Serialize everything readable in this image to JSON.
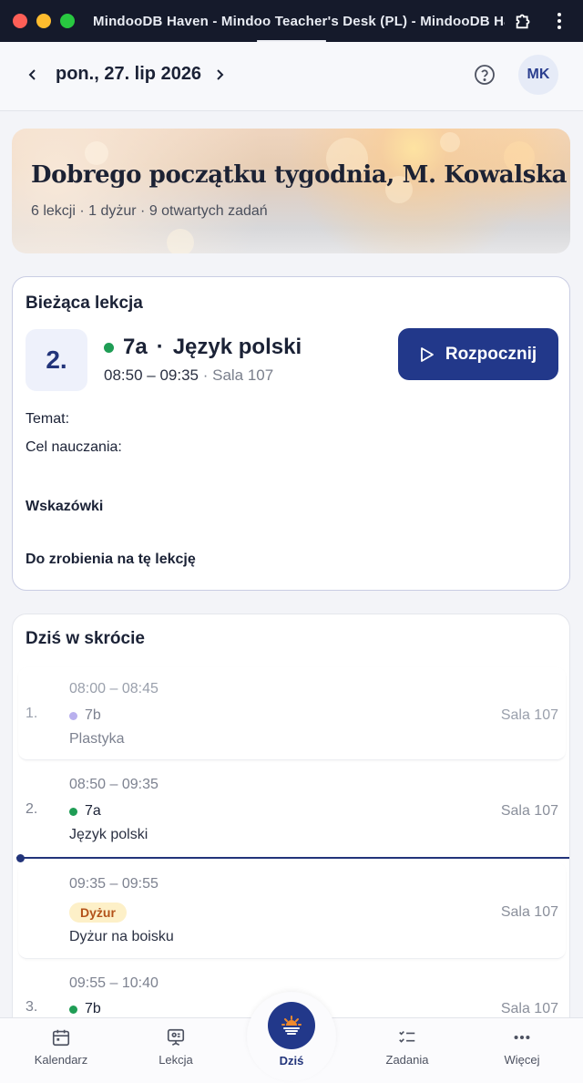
{
  "window": {
    "title": "MindooDB Haven - Mindoo Teacher's Desk (PL) - MindooDB Haven",
    "traffic_lights": [
      "#fe5f57",
      "#febc2e",
      "#28c840"
    ]
  },
  "header": {
    "date": "pon., 27. lip 2026",
    "prev_icon": "chevron-left-icon",
    "next_icon": "chevron-right-icon",
    "help_icon": "question-circle-icon",
    "avatar_initials": "MK"
  },
  "hero": {
    "title": "Dobrego początku tygodnia, M. Kowalska",
    "subtitle": "6 lekcji · 1 dyżur · 9 otwartych zadań"
  },
  "current_lesson": {
    "heading": "Bieżąca lekcja",
    "number": "2.",
    "class": "7a",
    "separator": "·",
    "subject": "Język polski",
    "time": "08:50 – 09:35",
    "room": "· Sala 107",
    "class_color": "#1f9d55",
    "start_button": "Rozpocznij",
    "fields": {
      "topic": "Temat:",
      "goal": "Cel nauczania:",
      "hints": "Wskazówki",
      "todo": "Do zrobienia na tę lekcję"
    }
  },
  "today": {
    "heading": "Dziś w skrócie",
    "rows": [
      {
        "num": "1.",
        "time": "08:00 – 08:45",
        "class": "7b",
        "subject": "Plastyka",
        "room": "Sala 107",
        "dot_color": "#b9b0ee",
        "past": true
      },
      {
        "num": "2.",
        "time": "08:50 – 09:35",
        "class": "7a",
        "subject": "Język polski",
        "room": "Sala 107",
        "dot_color": "#1f9d55",
        "past": false
      },
      {
        "num": "",
        "time": "09:35 – 09:55",
        "badge": "Dyżur",
        "subject": "Dyżur na boisku",
        "room": "Sala 107",
        "past": false
      },
      {
        "num": "3.",
        "time": "09:55 – 10:40",
        "class": "7b",
        "subject": "",
        "room": "Sala 107",
        "dot_color": "#1f9d55",
        "past": false
      }
    ]
  },
  "bottom_nav": {
    "calendar": "Kalendarz",
    "lesson": "Lekcja",
    "today": "Dziś",
    "tasks": "Zadania",
    "more": "Więcej"
  }
}
